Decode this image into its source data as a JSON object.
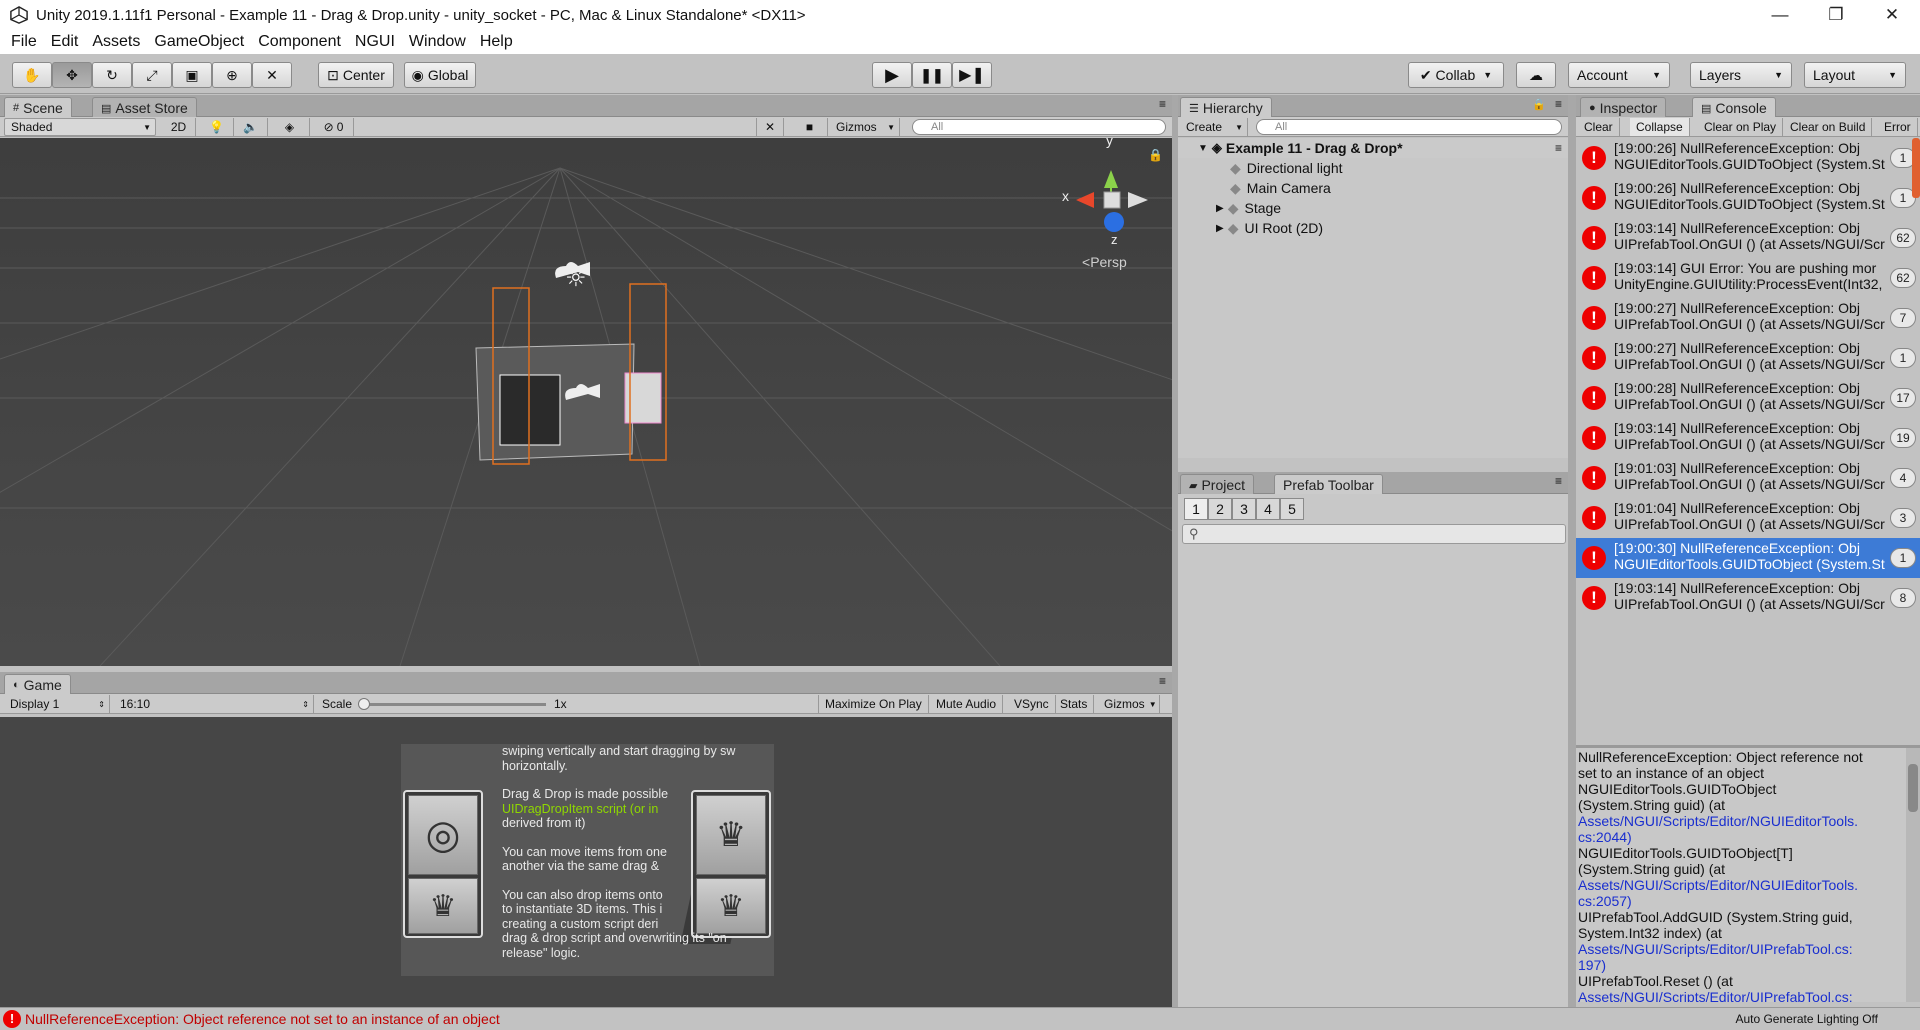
{
  "window": {
    "title": "Unity 2019.1.11f1 Personal - Example 11 - Drag & Drop.unity - unity_socket - PC, Mac & Linux Standalone* <DX11>",
    "minimize": "—",
    "maximize": "❐",
    "close": "✕"
  },
  "menu": [
    "File",
    "Edit",
    "Assets",
    "GameObject",
    "Component",
    "NGUI",
    "Window",
    "Help"
  ],
  "toolbar": {
    "center": "Center",
    "global": "Global",
    "collab": "Collab",
    "account": "Account",
    "layers": "Layers",
    "layout": "Layout"
  },
  "scene": {
    "tab": "Scene",
    "tab2": "Asset Store",
    "shading": "Shaded",
    "mode2d": "2D",
    "fx_count": "0",
    "gizmos": "Gizmos",
    "search_placeholder": "All",
    "persp": "Persp",
    "axes": {
      "x": "x",
      "y": "y",
      "z": "z"
    }
  },
  "game": {
    "tab": "Game",
    "display": "Display 1",
    "aspect": "16:10",
    "scale_label": "Scale",
    "scale_value": "1x",
    "buttons": [
      "Maximize On Play",
      "Mute Audio",
      "VSync",
      "Stats",
      "Gizmos"
    ],
    "text_lines": [
      "swiping vertically and start dragging by sw",
      "horizontally.",
      "",
      "Drag & Drop is made possible",
      "UIDragDropItem script (or in",
      "derived from it)",
      "",
      "You can move items from one",
      "another via the same drag &",
      "",
      "You can also drop items onto",
      "to instantiate 3D items. This i",
      "creating a custom script deri",
      "drag & drop script and overwriting its \"on",
      "release\" logic."
    ]
  },
  "hierarchy": {
    "tab": "Hierarchy",
    "create": "Create",
    "search_placeholder": "All",
    "scene_name": "Example 11 - Drag & Drop*",
    "items": [
      "Directional light",
      "Main Camera",
      "Stage",
      "UI Root (2D)"
    ]
  },
  "project": {
    "tab": "Project",
    "tab2": "Prefab Toolbar",
    "pages": [
      "1",
      "2",
      "3",
      "4",
      "5"
    ]
  },
  "console": {
    "tab_inspector": "Inspector",
    "tab_console": "Console",
    "buttons": [
      "Clear",
      "Collapse",
      "Clear on Play",
      "Clear on Build",
      "Error"
    ],
    "entries": [
      {
        "l1": "[19:00:26] NullReferenceException: Obj",
        "l2": "NGUIEditorTools.GUIDToObject (System.St",
        "count": "1"
      },
      {
        "l1": "[19:00:26] NullReferenceException: Obj",
        "l2": "NGUIEditorTools.GUIDToObject (System.St",
        "count": "1"
      },
      {
        "l1": "[19:03:14] NullReferenceException: Obj",
        "l2": "UIPrefabTool.OnGUI () (at Assets/NGUI/Scr",
        "count": "62"
      },
      {
        "l1": "[19:03:14] GUI Error: You are pushing mor",
        "l2": "UnityEngine.GUIUtility:ProcessEvent(Int32,",
        "count": "62"
      },
      {
        "l1": "[19:00:27] NullReferenceException: Obj",
        "l2": "UIPrefabTool.OnGUI () (at Assets/NGUI/Scr",
        "count": "7"
      },
      {
        "l1": "[19:00:27] NullReferenceException: Obj",
        "l2": "UIPrefabTool.OnGUI () (at Assets/NGUI/Scr",
        "count": "1"
      },
      {
        "l1": "[19:00:28] NullReferenceException: Obj",
        "l2": "UIPrefabTool.OnGUI () (at Assets/NGUI/Scr",
        "count": "17"
      },
      {
        "l1": "[19:03:14] NullReferenceException: Obj",
        "l2": "UIPrefabTool.OnGUI () (at Assets/NGUI/Scr",
        "count": "19"
      },
      {
        "l1": "[19:01:03] NullReferenceException: Obj",
        "l2": "UIPrefabTool.OnGUI () (at Assets/NGUI/Scr",
        "count": "4"
      },
      {
        "l1": "[19:01:04] NullReferenceException: Obj",
        "l2": "UIPrefabTool.OnGUI () (at Assets/NGUI/Scr",
        "count": "3"
      },
      {
        "l1": "[19:00:30] NullReferenceException: Obj",
        "l2": "NGUIEditorTools.GUIDToObject (System.St",
        "count": "1",
        "selected": true
      },
      {
        "l1": "[19:03:14] NullReferenceException: Obj",
        "l2": "UIPrefabTool.OnGUI () (at Assets/NGUI/Scr",
        "count": "8"
      }
    ],
    "detail": [
      {
        "t": "NullReferenceException: Object reference not",
        "link": false
      },
      {
        "t": "set to an instance of an object",
        "link": false
      },
      {
        "t": "NGUIEditorTools.GUIDToObject",
        "link": false
      },
      {
        "t": "(System.String guid) (at",
        "link": false
      },
      {
        "t": "Assets/NGUI/Scripts/Editor/NGUIEditorTools.",
        "link": true
      },
      {
        "t": "cs:2044)",
        "link": true
      },
      {
        "t": "NGUIEditorTools.GUIDToObject[T]",
        "link": false
      },
      {
        "t": "(System.String guid) (at",
        "link": false
      },
      {
        "t": "Assets/NGUI/Scripts/Editor/NGUIEditorTools.",
        "link": true
      },
      {
        "t": "cs:2057)",
        "link": true
      },
      {
        "t": "UIPrefabTool.AddGUID (System.String guid,",
        "link": false
      },
      {
        "t": "System.Int32 index) (at",
        "link": false
      },
      {
        "t": "Assets/NGUI/Scripts/Editor/UIPrefabTool.cs:",
        "link": true
      },
      {
        "t": "197)",
        "link": true
      },
      {
        "t": "UIPrefabTool.Reset () (at",
        "link": false
      },
      {
        "t": "Assets/NGUI/Scripts/Editor/UIPrefabTool.cs:",
        "link": true
      }
    ]
  },
  "status": {
    "message": "NullReferenceException: Object reference not set to an instance of an object",
    "right": "Auto Generate Lighting Off"
  },
  "colors": {
    "error": "#e00000",
    "selection": "#3d7bd6",
    "link": "#1a2fcf"
  }
}
